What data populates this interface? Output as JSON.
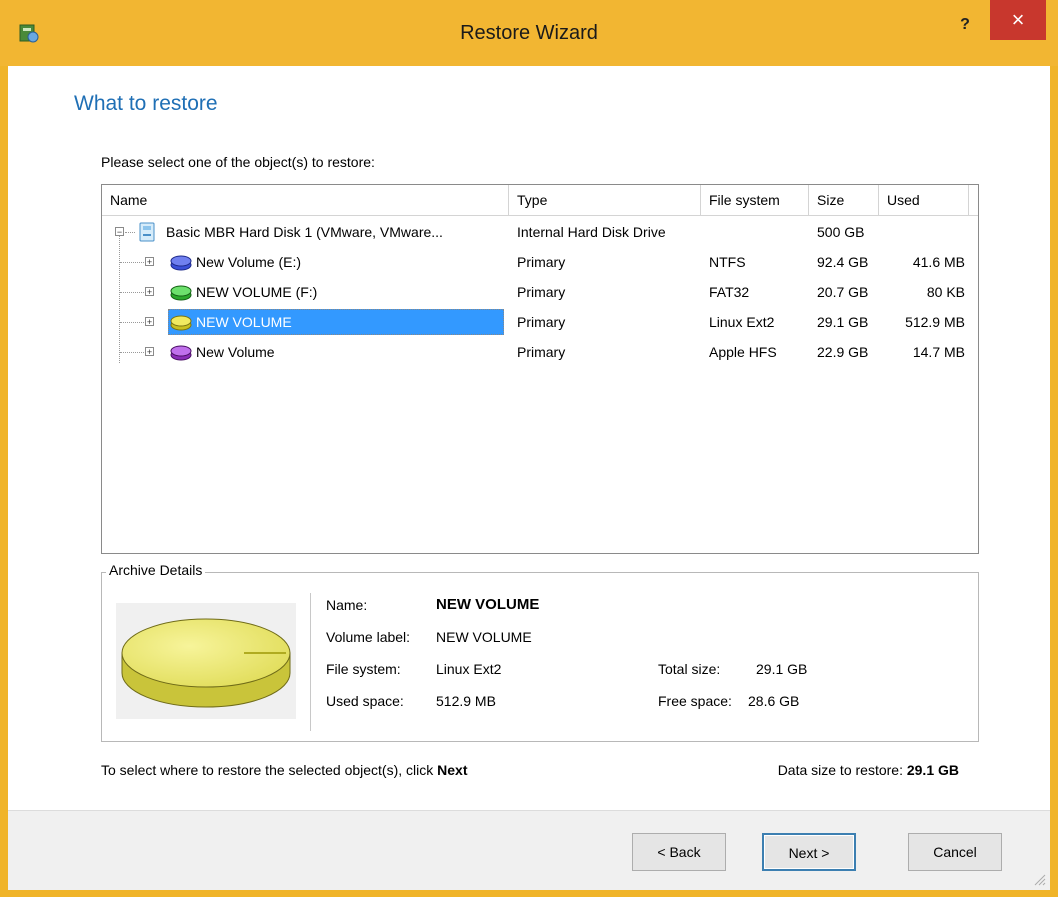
{
  "window": {
    "title": "Restore Wizard",
    "help_label": "?",
    "close_label": "×"
  },
  "page": {
    "heading": "What to restore",
    "prompt": "Please select one of the object(s) to restore:"
  },
  "table": {
    "columns": [
      "Name",
      "Type",
      "File system",
      "Size",
      "Used"
    ],
    "disk": {
      "name": "Basic MBR Hard Disk 1 (VMware, VMware...",
      "type": "Internal Hard Disk Drive",
      "fs": "",
      "size": "500 GB",
      "used": ""
    },
    "volumes": [
      {
        "name": "New Volume (E:)",
        "type": "Primary",
        "fs": "NTFS",
        "size": "92.4 GB",
        "used": "41.6 MB",
        "color": "#3a4fd8"
      },
      {
        "name": "NEW VOLUME (F:)",
        "type": "Primary",
        "fs": "FAT32",
        "size": "20.7 GB",
        "used": "80 KB",
        "color": "#3cc43c"
      },
      {
        "name": "NEW VOLUME",
        "type": "Primary",
        "fs": "Linux Ext2",
        "size": "29.1 GB",
        "used": "512.9 MB",
        "color": "#e8e030",
        "selected": true
      },
      {
        "name": "New Volume",
        "type": "Primary",
        "fs": "Apple HFS",
        "size": "22.9 GB",
        "used": "14.7 MB",
        "color": "#9a3cc8"
      }
    ]
  },
  "details": {
    "legend": "Archive Details",
    "name_label": "Name:",
    "name_value": "NEW VOLUME",
    "label_label": "Volume label:",
    "label_value": "NEW VOLUME",
    "fs_label": "File system:",
    "fs_value": "Linux Ext2",
    "used_label": "Used space:",
    "used_value": "512.9 MB",
    "total_label": "Total size:",
    "total_value": "29.1 GB",
    "free_label": "Free space:",
    "free_value": "28.6 GB"
  },
  "bottom": {
    "note_prefix": "To select where to restore the selected object(s), click ",
    "note_bold": "Next",
    "size_label": "Data size to restore: ",
    "size_value": "29.1 GB"
  },
  "buttons": {
    "back": "< Back",
    "next": "Next >",
    "cancel": "Cancel"
  },
  "colors": {
    "accent": "#1f6fb5",
    "frame": "#f2b632",
    "selection": "#3399ff",
    "close": "#c8372d"
  }
}
